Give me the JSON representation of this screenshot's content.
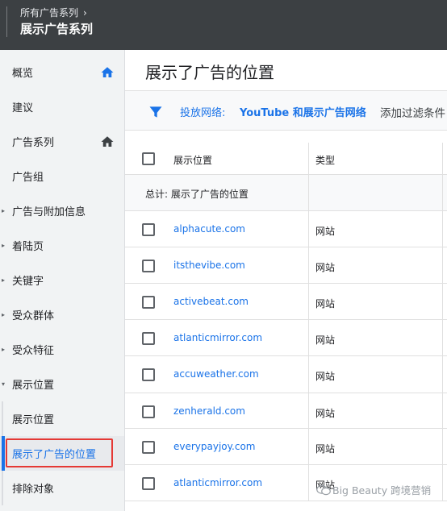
{
  "header": {
    "breadcrumb": "所有广告系列",
    "campaign_title": "展示广告系列"
  },
  "sidebar": {
    "items": [
      {
        "label": "概览",
        "home": true
      },
      {
        "label": "建议"
      },
      {
        "label": "广告系列",
        "home": true
      },
      {
        "label": "广告组"
      },
      {
        "label": "广告与附加信息",
        "expandable": true
      },
      {
        "label": "着陆页",
        "expandable": true
      },
      {
        "label": "关键字",
        "expandable": true
      },
      {
        "label": "受众群体",
        "expandable": true
      },
      {
        "label": "受众特征",
        "expandable": true
      },
      {
        "label": "展示位置",
        "expanded": true
      },
      {
        "label": "展示位置",
        "sub": true
      },
      {
        "label": "展示了广告的位置",
        "sub": true,
        "active": true
      },
      {
        "label": "排除对象",
        "sub": true
      }
    ]
  },
  "main": {
    "title": "展示了广告的位置",
    "filter": {
      "label": "投放网络:",
      "value": "YouTube 和展示广告网络",
      "add": "添加过滤条件"
    },
    "table": {
      "columns": [
        "展示位置",
        "类型"
      ],
      "total_label": "总计: 展示了广告的位置",
      "rows": [
        {
          "placement": "alphacute.com",
          "type": "网站"
        },
        {
          "placement": "itsthevibe.com",
          "type": "网站"
        },
        {
          "placement": "activebeat.com",
          "type": "网站"
        },
        {
          "placement": "atlanticmirror.com",
          "type": "网站"
        },
        {
          "placement": "accuweather.com",
          "type": "网站"
        },
        {
          "placement": "zenherald.com",
          "type": "网站"
        },
        {
          "placement": "everypayjoy.com",
          "type": "网站"
        },
        {
          "placement": "atlanticmirror.com",
          "type": "网站"
        }
      ]
    }
  },
  "watermark": "Big Beauty 跨境营销",
  "colors": {
    "header_bg": "#3c4043",
    "accent": "#1a73e8",
    "highlight_box": "#e53935",
    "sidebar_bg": "#f1f3f4"
  },
  "icons": [
    "chevron-right-icon",
    "home-icon",
    "expand-arrow-icon",
    "collapse-arrow-icon",
    "filter-icon",
    "checkbox-icon",
    "wechat-icon"
  ]
}
